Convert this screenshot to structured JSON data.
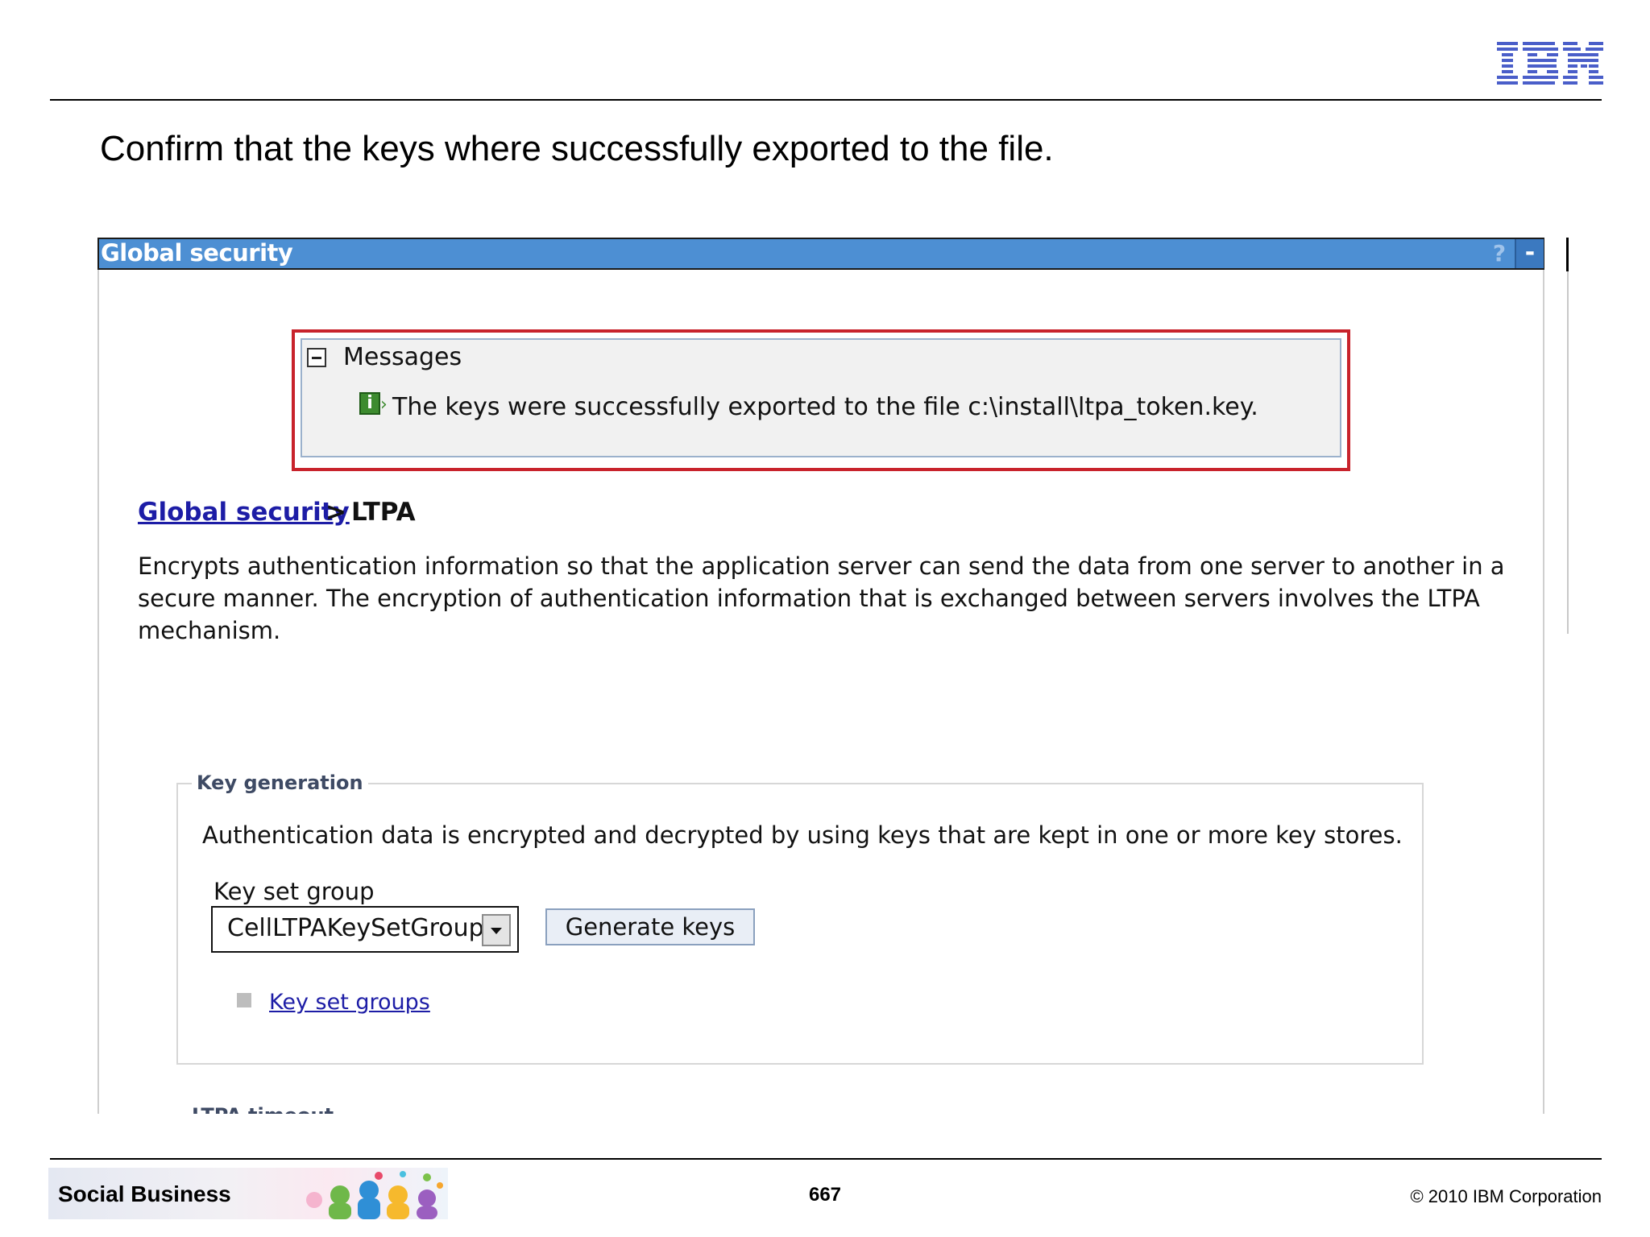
{
  "slide": {
    "title": "Confirm that the keys where successfully exported to the file.",
    "logo": "IBM",
    "footer_brand": "Social Business",
    "page_number": "667",
    "copyright": "© 2010 IBM Corporation"
  },
  "panel": {
    "title": "Global security",
    "help_label": "?",
    "minimize_label": "-",
    "header_color": "#4d8fd3"
  },
  "messages": {
    "title": "Messages",
    "info_icon": "i",
    "text": "The keys were successfully exported to the file c:\\install\\ltpa_token.key.",
    "highlight_color": "#c8232c"
  },
  "breadcrumb": {
    "link": "Global security",
    "separator": ">",
    "current": "LTPA"
  },
  "description": {
    "line1": "Encrypts authentication information so that the application server can send the data from one server to another in a",
    "line2": "secure manner. The encryption of authentication information that is exchanged between servers involves the LTPA",
    "line3": "mechanism."
  },
  "key_generation": {
    "legend": "Key generation",
    "description": "Authentication data is encrypted and decrypted by using keys that are kept in one or more key stores.",
    "key_set_group_label": "Key set group",
    "key_set_group_value": "CellLTPAKeySetGroup",
    "generate_button": "Generate keys",
    "key_set_groups_link": "Key set groups"
  },
  "ltpa_timeout": {
    "legend": "LTPA timeout"
  }
}
